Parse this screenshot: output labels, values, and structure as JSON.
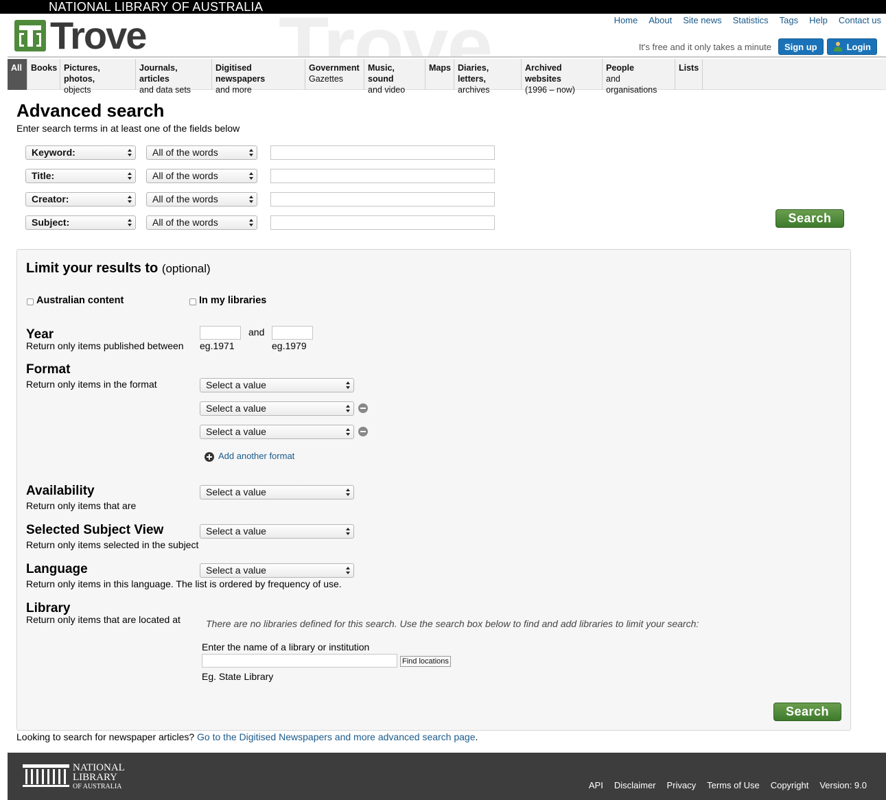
{
  "topbar": {
    "org": "NATIONAL LIBRARY OF AUSTRALIA"
  },
  "header": {
    "logo_text": "Trove",
    "watermark": "Trove",
    "links": [
      "Home",
      "About",
      "Site news",
      "Statistics",
      "Tags",
      "Help",
      "Contact us"
    ],
    "free_text": "It's free and it only takes a minute",
    "signup_label": "Sign up",
    "login_label": "Login"
  },
  "nav": {
    "tabs": [
      {
        "t1": "All",
        "t2": ""
      },
      {
        "t1": "Books",
        "t2": ""
      },
      {
        "t1": "Pictures, photos,",
        "t2": "objects"
      },
      {
        "t1": "Journals, articles",
        "t2": "and data sets"
      },
      {
        "t1": "Digitised newspapers",
        "t2": "and more"
      },
      {
        "t1": "Government",
        "t2": "Gazettes"
      },
      {
        "t1": "Music, sound",
        "t2": "and video"
      },
      {
        "t1": "Maps",
        "t2": ""
      },
      {
        "t1": "Diaries, letters,",
        "t2": "archives"
      },
      {
        "t1": "Archived websites",
        "t2": "(1996 – now)"
      },
      {
        "t1": "People",
        "t2": "and organisations"
      },
      {
        "t1": "Lists",
        "t2": ""
      }
    ]
  },
  "main": {
    "title": "Advanced search",
    "subtitle": "Enter search terms in at least one of the fields below",
    "rows": [
      {
        "field": "Keyword:",
        "mode": "All of the words",
        "value": ""
      },
      {
        "field": "Title:",
        "mode": "All of the words",
        "value": ""
      },
      {
        "field": "Creator:",
        "mode": "All of the words",
        "value": ""
      },
      {
        "field": "Subject:",
        "mode": "All of the words",
        "value": ""
      }
    ],
    "search_label": "Search"
  },
  "limit": {
    "heading": "Limit your results to",
    "heading_opt": "(optional)",
    "australian": "Australian content",
    "my_libraries": "In my libraries",
    "year": {
      "heading": "Year",
      "desc": "Return only items published between",
      "and": "and",
      "from_hint": "eg.1971",
      "to_hint": "eg.1979"
    },
    "format": {
      "heading": "Format",
      "desc": "Return only items in the format",
      "selects": [
        "Select a value",
        "Select a value",
        "Select a value"
      ],
      "add_label": "Add another format"
    },
    "availability": {
      "heading": "Availability",
      "desc": "Return only items that are",
      "value": "Select a value"
    },
    "subject_view": {
      "heading": "Selected Subject View",
      "desc": "Return only items selected in the subject",
      "value": "Select a value"
    },
    "language": {
      "heading": "Language",
      "desc": "Return only items in this language. The list is ordered by frequency of use.",
      "value": "Select a value"
    },
    "library": {
      "heading": "Library",
      "desc": "Return only items that are located at",
      "note": "There are no libraries defined for this search. Use the search box below to find and add libraries to limit your search:",
      "input_label": "Enter the name of a library or institution",
      "find_label": "Find locations",
      "example": "Eg. State Library"
    },
    "search_label": "Search"
  },
  "bottom": {
    "prefix": "Looking to search for newspaper articles?",
    "link": "Go to the Digitised Newspapers and more advanced search page",
    "suffix": "."
  },
  "footer": {
    "logo_line1": "NATIONAL",
    "logo_line2": "LIBRARY",
    "logo_line3": "OF AUSTRALIA",
    "links": [
      "API",
      "Disclaimer",
      "Privacy",
      "Terms of Use",
      "Copyright"
    ],
    "version": "Version: 9.0"
  },
  "colors": {
    "brand_green": "#4e8a3a",
    "button_blue": "#1a73b8",
    "footer_bg": "#3d3d3d"
  }
}
